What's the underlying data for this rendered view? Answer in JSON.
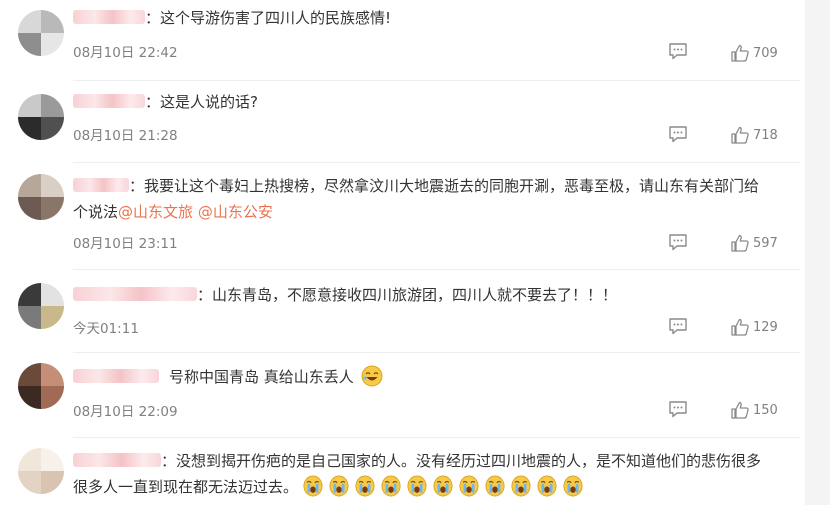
{
  "comments": [
    {
      "text": "：这个导游伤害了四川人的民族感情!",
      "time": "08月10日 22:42",
      "likes": "709",
      "avatar_colors": [
        "#d8d8d8",
        "#b9b9b9",
        "#8e8e8e",
        "#e6e6e6"
      ]
    },
    {
      "text": "：这是人说的话?",
      "time": "08月10日 21:28",
      "likes": "718",
      "avatar_colors": [
        "#c9c9c9",
        "#2b2b2b",
        "#505050",
        "#9a9a9a"
      ]
    },
    {
      "line1": "：我要让这个毒妇上热搜榜，尽然拿汶川大地震逝去的同胞开涮，恶毒至极，请山东有关部门给",
      "line2_prefix": "个说法",
      "mention1": "@山东文旅",
      "mention2": "@山东公安",
      "time": "08月10日 23:11",
      "likes": "597",
      "avatar_colors": [
        "#b7a79a",
        "#6d5a52",
        "#d9cfc4",
        "#8a7669"
      ]
    },
    {
      "text": "：山东青岛，不愿意接收四川旅游团，四川人就不要去了！！！",
      "time": "今天01:11",
      "likes": "129",
      "avatar_colors": [
        "#3a3a3a",
        "#e2e2e2",
        "#7a7a7a",
        "#c9b98a"
      ]
    },
    {
      "text": "号称中国青岛 真给山东丢人",
      "time": "08月10日 22:09",
      "likes": "150",
      "avatar_colors": [
        "#6b4a3a",
        "#a06a55",
        "#3c2a22",
        "#c58f77"
      ]
    },
    {
      "line1": "：没想到揭开伤疤的是自己国家的人。没有经历过四川地震的人，是不知道他们的悲伤很多",
      "line2": "很多人一直到现在都无法迈过去。",
      "emoji_count": 11,
      "avatar_colors": [
        "#f1e6da",
        "#e2d3c2",
        "#f8f1ea",
        "#d8c4b0"
      ]
    }
  ],
  "icons": {
    "reply": "comment-icon",
    "like": "thumbs-up-icon",
    "emoji_laugh": "laugh-emoji-icon",
    "emoji_cry": "crying-emoji-icon"
  },
  "colors": {
    "mention": "#eb7350",
    "meta": "#808080",
    "text": "#333333",
    "emoji_fill": "#f7c948"
  }
}
